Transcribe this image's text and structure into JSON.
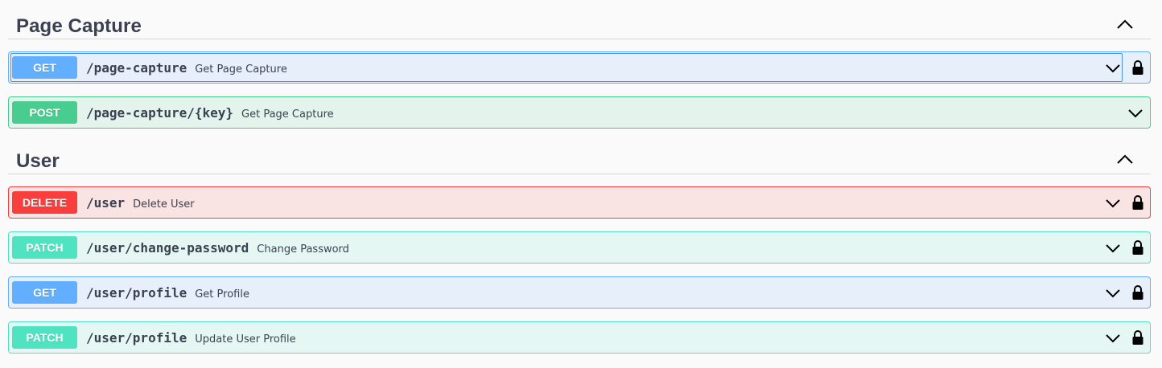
{
  "sections": [
    {
      "title": "Page Capture",
      "operations": [
        {
          "method": "GET",
          "path": "/page-capture",
          "summary": "Get Page Capture",
          "locked": true
        },
        {
          "method": "POST",
          "path": "/page-capture/{key}",
          "summary": "Get Page Capture",
          "locked": false
        }
      ]
    },
    {
      "title": "User",
      "operations": [
        {
          "method": "DELETE",
          "path": "/user",
          "summary": "Delete User",
          "locked": true
        },
        {
          "method": "PATCH",
          "path": "/user/change-password",
          "summary": "Change Password",
          "locked": true
        },
        {
          "method": "GET",
          "path": "/user/profile",
          "summary": "Get Profile",
          "locked": true
        },
        {
          "method": "PATCH",
          "path": "/user/profile",
          "summary": "Update User Profile",
          "locked": true
        }
      ]
    }
  ],
  "icons": {
    "section_toggle": "chevron-up-icon",
    "op_toggle": "chevron-down-icon",
    "auth": "lock-icon"
  },
  "colors": {
    "get": "#61affe",
    "post": "#49cc90",
    "delete": "#f93e3e",
    "patch": "#50e3c2",
    "text": "#3b4151"
  }
}
